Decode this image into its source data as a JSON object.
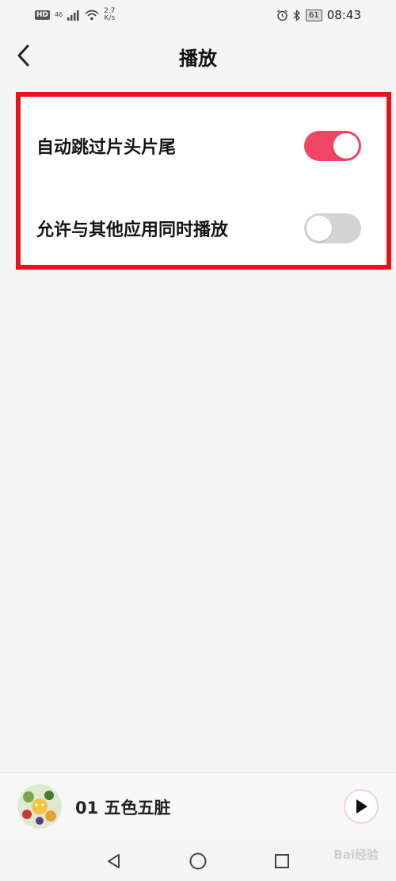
{
  "status_bar": {
    "hd": "HD",
    "network": "46",
    "speed_value": "2.7",
    "speed_unit": "K/s",
    "battery": "61",
    "time": "08:43"
  },
  "header": {
    "title": "播放"
  },
  "settings": [
    {
      "label": "自动跳过片头片尾",
      "enabled": true
    },
    {
      "label": "允许与其他应用同时播放",
      "enabled": false
    }
  ],
  "player": {
    "track_title": "01 五色五脏"
  },
  "watermark": "Bai经验",
  "colors": {
    "accent": "#f24563",
    "highlight_border": "#e8111d",
    "toggle_off": "#d4d4d4",
    "background": "#f4f4f4"
  }
}
